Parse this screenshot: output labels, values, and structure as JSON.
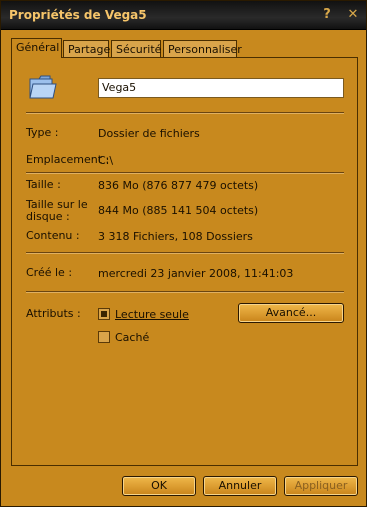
{
  "window": {
    "title": "Propriétés de Vega5",
    "help_glyph": "?",
    "close_glyph": "✕"
  },
  "tabs": [
    {
      "label": "Général"
    },
    {
      "label": "Partage"
    },
    {
      "label": "Sécurité"
    },
    {
      "label": "Personnaliser"
    }
  ],
  "general": {
    "icon": "folder-icon",
    "name": "Vega5",
    "rows": {
      "type": {
        "label": "Type :",
        "value": "Dossier de fichiers"
      },
      "location": {
        "label": "Emplacement :",
        "value": "C:\\"
      },
      "size": {
        "label": "Taille :",
        "value": "836 Mo (876 877 479 octets)"
      },
      "size_on_disk": {
        "label": "Taille sur le disque :",
        "value": "844 Mo (885 141 504 octets)"
      },
      "contents": {
        "label": "Contenu :",
        "value": "3 318 Fichiers, 108 Dossiers"
      },
      "created": {
        "label": "Créé le :",
        "value": "mercredi 23 janvier 2008, 11:41:03"
      }
    },
    "attributes": {
      "label": "Attributs :",
      "readonly": {
        "label": "Lecture seule",
        "checked": true
      },
      "hidden": {
        "label": "Caché",
        "checked": false
      },
      "advanced_button": "Avancé..."
    }
  },
  "footer": {
    "ok": "OK",
    "cancel": "Annuler",
    "apply": "Appliquer"
  }
}
